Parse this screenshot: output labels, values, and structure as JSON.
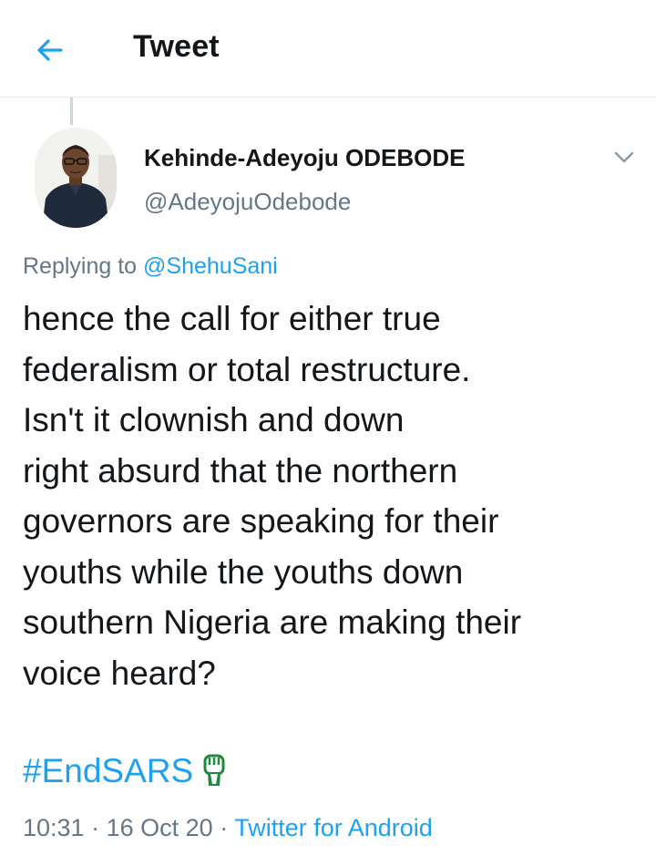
{
  "header": {
    "title": "Tweet",
    "back_icon": "arrow-left-icon"
  },
  "colors": {
    "accent": "#1da1f2",
    "text": "#14171a",
    "muted": "#657786",
    "divider": "#e1e8ed"
  },
  "tweet": {
    "author": {
      "display_name": "Kehinde-Adeyoju ODEBODE",
      "handle": "@AdeyojuOdebode",
      "avatar_icon": "avatar"
    },
    "menu_icon": "chevron-down-icon",
    "replying_prefix": "Replying to",
    "replying_to": "@ShehuSani",
    "text_lines": [
      "hence the call for either true",
      "federalism or total restructure.",
      "Isn't it clownish and down",
      "right absurd that the northern",
      "governors are speaking for their",
      "youths while the youths down",
      "southern Nigeria are making their",
      "voice heard?"
    ],
    "hashtag": "#EndSARS",
    "hashtag_emoji_icon": "raised-fist-icon",
    "time": "10:31",
    "separator": "·",
    "date": "16 Oct 20",
    "source": "Twitter for Android"
  }
}
